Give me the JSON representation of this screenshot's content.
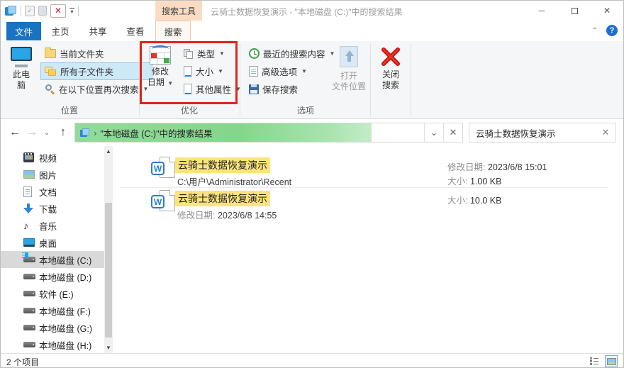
{
  "colors": {
    "accent_blue": "#1873c2",
    "contextual_peach": "#fbdcc3",
    "highlight_yellow": "#fbe47a",
    "progress_green": "#84d68c",
    "redbox": "#de2517"
  },
  "titlebar": {
    "contextual_tab": "搜索工具",
    "title": "云骑士数据恢复演示 - \"本地磁盘 (C:)\"中的搜索结果"
  },
  "tabs": {
    "file": "文件",
    "home": "主页",
    "share": "共享",
    "view": "查看",
    "search": "搜索"
  },
  "ribbon": {
    "location": {
      "label": "位置",
      "this_pc": [
        "此电",
        "脑"
      ],
      "current_folder": "当前文件夹",
      "all_subfolders": "所有子文件夹",
      "search_again": "在以下位置再次搜索"
    },
    "refine": {
      "label": "优化",
      "date_modified": [
        "修改",
        "日期"
      ],
      "kind": "类型",
      "size": "大小",
      "other_properties": "其他属性"
    },
    "options": {
      "label": "选项",
      "recent_searches": "最近的搜索内容",
      "advanced_options": "高级选项",
      "save_search": "保存搜索",
      "open_file_location": [
        "打开",
        "文件位置"
      ],
      "close_search": [
        "关闭",
        "搜索"
      ]
    }
  },
  "navbar": {
    "address": "\"本地磁盘 (C:)\"中的搜索结果",
    "search_value": "云骑士数据恢复演示"
  },
  "sidebar": {
    "items": [
      {
        "label": "视频"
      },
      {
        "label": "图片"
      },
      {
        "label": "文档"
      },
      {
        "label": "下载"
      },
      {
        "label": "音乐"
      },
      {
        "label": "桌面"
      },
      {
        "label": "本地磁盘 (C:)"
      },
      {
        "label": "本地磁盘 (D:)"
      },
      {
        "label": "软件 (E:)"
      },
      {
        "label": "本地磁盘 (F:)"
      },
      {
        "label": "本地磁盘 (G:)"
      },
      {
        "label": "本地磁盘 (H:)"
      }
    ]
  },
  "files": [
    {
      "name": "云骑士数据恢复演示",
      "subtitle": "C:\\用户\\Administrator\\Recent",
      "date_label": "修改日期:",
      "date_value": "2023/6/8 15:01",
      "size_label": "大小:",
      "size_value": "1.00 KB"
    },
    {
      "name": "云骑士数据恢复演示",
      "sub_label": "修改日期:",
      "sub_value": "2023/6/8 14:55",
      "size_label": "大小:",
      "size_value": "10.0 KB"
    }
  ],
  "statusbar": {
    "count": "2 个项目"
  }
}
